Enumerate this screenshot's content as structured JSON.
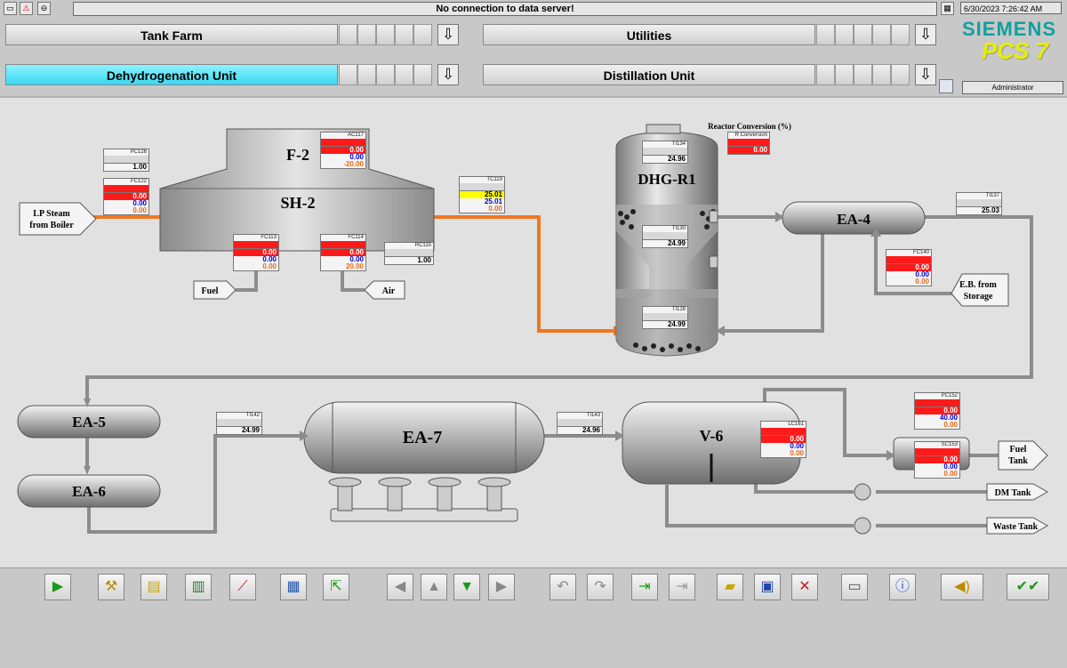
{
  "status_message": "No connection to data server!",
  "datetime": "6/30/2023 7:26:42 AM",
  "user": "Administrator",
  "brand": {
    "line1": "SIEMENS",
    "line2": "PCS 7"
  },
  "nav": {
    "tank_farm": "Tank Farm",
    "utilities": "Utilities",
    "dehydrogenation": "Dehydrogenation Unit",
    "distillation": "Distillation Unit"
  },
  "equipment": {
    "f2": "F-2",
    "sh2": "SH-2",
    "dhg_r1": "DHG-R1",
    "ea4": "EA-4",
    "ea5": "EA-5",
    "ea6": "EA-6",
    "ea7": "EA-7",
    "v6": "V-6"
  },
  "streams": {
    "lp_steam_1": "LP Steam",
    "lp_steam_2": "from Boiler",
    "fuel": "Fuel",
    "air": "Air",
    "eb_1": "E.B. from",
    "eb_2": "Storage",
    "fuel_tank_1": "Fuel",
    "fuel_tank_2": "Tank",
    "dm_tank": "DM Tank",
    "waste_tank": "Waste Tank"
  },
  "reactor_conversion_label": "Reactor Conversion (%)",
  "faceplates": {
    "pc126": {
      "tag": "PC126",
      "v1": "1.00"
    },
    "fc122": {
      "tag": "FC122",
      "v1": "0.00",
      "v2": "0.00",
      "v3": "0.00"
    },
    "ac117": {
      "tag": "AC117",
      "v1": "0.00",
      "v2": "0.00",
      "v3": "-20.00"
    },
    "tc119": {
      "tag": "TC119",
      "v1": "25.01",
      "v2": "25.01",
      "v3": "0.00"
    },
    "fc113": {
      "tag": "FC113",
      "v1": "0.00",
      "v2": "0.00",
      "v3": "0.00"
    },
    "fc114": {
      "tag": "FC114",
      "v1": "0.00",
      "v2": "0.00",
      "v3": "20.00"
    },
    "rc115": {
      "tag": "RC115",
      "v1": "1.00"
    },
    "ti134": {
      "tag": "TI134",
      "v1": "24.96"
    },
    "r_conv": {
      "tag": "R Conversion",
      "v1": "0.00"
    },
    "ti130": {
      "tag": "TI130",
      "v1": "24.99"
    },
    "ti128": {
      "tag": "TI128",
      "v1": "24.99"
    },
    "ti137": {
      "tag": "TI137",
      "v1": "25.03"
    },
    "fc140": {
      "tag": "FC140",
      "v1": "0.00",
      "v2": "0.00",
      "v3": "0.00"
    },
    "ti142": {
      "tag": "TI142",
      "v1": "24.99"
    },
    "ti143": {
      "tag": "TI143",
      "v1": "24.96"
    },
    "lc161": {
      "tag": "LC161",
      "v1": "0.00",
      "v2": "0.00",
      "v3": "0.00"
    },
    "pc152": {
      "tag": "PC152",
      "v1": "0.00",
      "v2": "40.00",
      "v3": "0.00"
    },
    "sc153": {
      "tag": "SC153",
      "v1": "0.00",
      "v2": "0.00",
      "v3": "0.00"
    }
  },
  "toolbar_icons": [
    "play-icon",
    "wrench-icon",
    "notepad-icon",
    "report-icon",
    "trend-icon",
    "thermometer-icon",
    "export-icon",
    "arrow-left-icon",
    "arrow-up-icon",
    "arrow-down-icon",
    "arrow-right-icon",
    "undo-icon",
    "redo-icon",
    "login-icon",
    "logout-icon",
    "folder-open-icon",
    "save-icon",
    "delete-icon",
    "monitor-icon",
    "info-icon",
    "horn-icon",
    "acknowledge-icon"
  ],
  "colors": {
    "alarm_red": "#ff0000",
    "setpoint_blue": "#0000cc",
    "output_orange": "#e06a1b",
    "steam_orange": "#f07820",
    "active_cyan": "#37d9f2"
  }
}
